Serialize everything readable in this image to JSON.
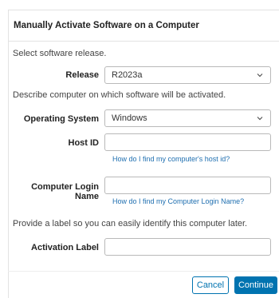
{
  "dialog": {
    "title": "Manually Activate Software on a Computer"
  },
  "sections": {
    "release_prompt": "Select software release.",
    "computer_prompt": "Describe computer on which software will be activated.",
    "label_prompt": "Provide a label so you can easily identify this computer later."
  },
  "fields": {
    "release": {
      "label": "Release",
      "value": "R2023a"
    },
    "os": {
      "label": "Operating System",
      "value": "Windows"
    },
    "host_id": {
      "label": "Host ID",
      "value": "",
      "help": "How do I find my computer's host id?"
    },
    "login_name": {
      "label": "Computer Login Name",
      "value": "",
      "help": "How do I find my Computer Login Name?"
    },
    "activation_label": {
      "label": "Activation Label",
      "value": ""
    }
  },
  "buttons": {
    "cancel": "Cancel",
    "continue": "Continue"
  },
  "colors": {
    "accent": "#0073b0",
    "link": "#1f6fb0"
  }
}
